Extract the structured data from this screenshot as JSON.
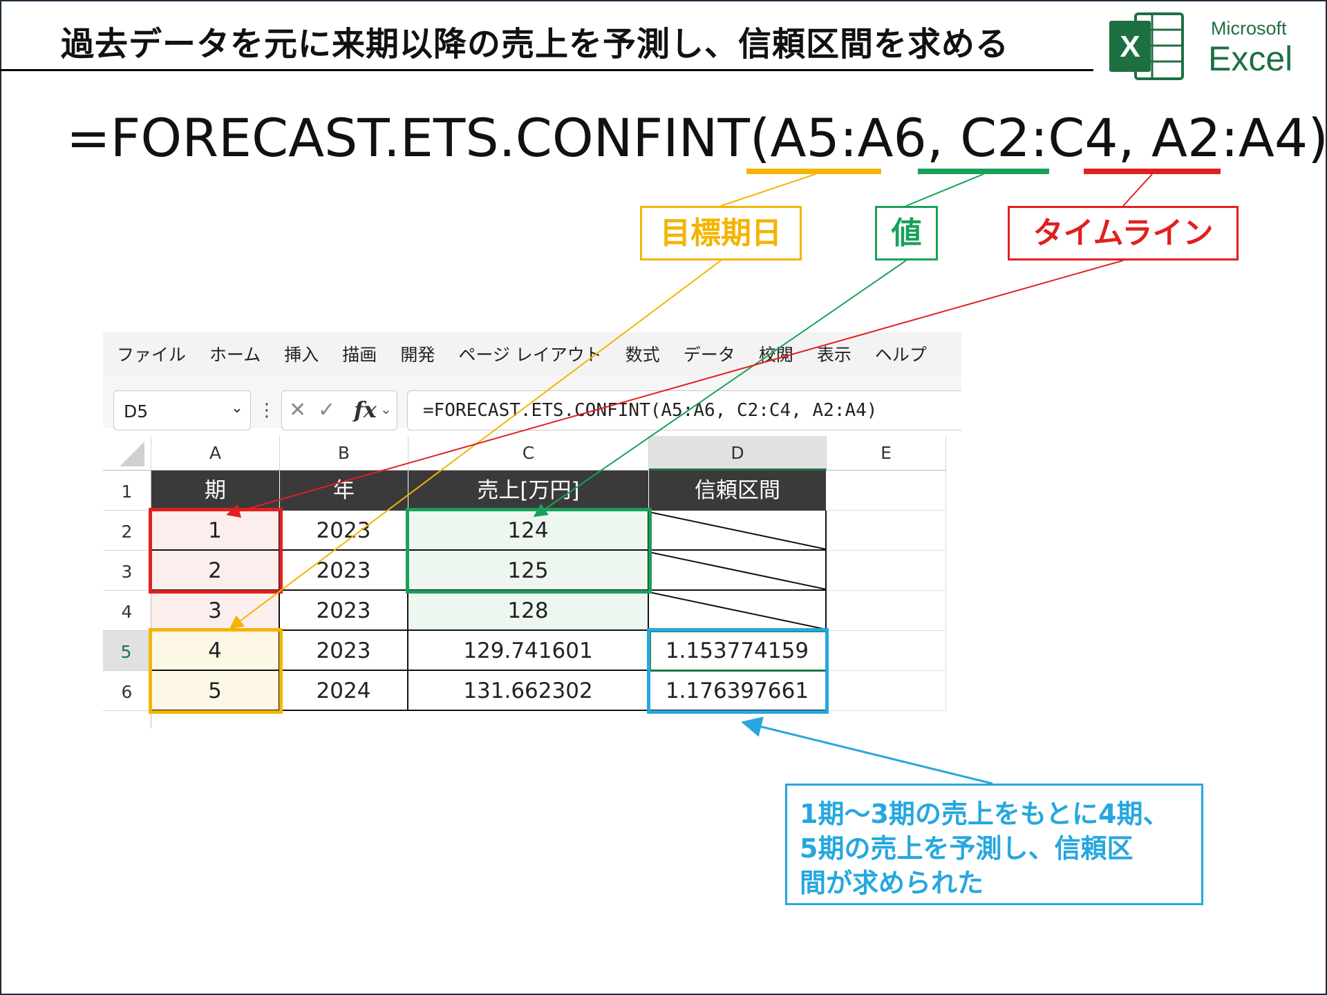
{
  "header": {
    "title": "過去データを元に来期以降の売上を予測し、信頼区間を求める",
    "logo_microsoft": "Microsoft",
    "logo_excel": "Excel",
    "logo_letter": "X"
  },
  "formula_display": {
    "prefix": "=FORECAST.ETS.CONFINT(",
    "arg1": "A5:A6",
    "sep1": ", ",
    "arg2": "C2:C4",
    "sep2": ", ",
    "arg3": "A2:A4",
    "suffix": ")"
  },
  "callouts": {
    "target_date": "目標期日",
    "values": "値",
    "timeline": "タイムライン",
    "note_lines": [
      "1期～3期の売上をもとに4期、",
      "5期の売上を予測し、信頼区",
      "間が求められた"
    ]
  },
  "excel": {
    "ribbon_tabs": [
      "ファイル",
      "ホーム",
      "挿入",
      "描画",
      "開発",
      "ページ レイアウト",
      "数式",
      "データ",
      "校閲",
      "表示",
      "ヘルプ"
    ],
    "name_box": "D5",
    "formula_bar": "=FORECAST.ETS.CONFINT(A5:A6, C2:C4, A2:A4)",
    "fx_label": "fx",
    "columns": [
      "A",
      "B",
      "C",
      "D",
      "E"
    ],
    "row_numbers": [
      "1",
      "2",
      "3",
      "4",
      "5",
      "6"
    ],
    "table_headers": [
      "期",
      "年",
      "売上[万円]",
      "信頼区間"
    ],
    "rows": [
      {
        "period": "1",
        "year": "2023",
        "sales": "124",
        "confint": ""
      },
      {
        "period": "2",
        "year": "2023",
        "sales": "125",
        "confint": ""
      },
      {
        "period": "3",
        "year": "2023",
        "sales": "128",
        "confint": ""
      },
      {
        "period": "4",
        "year": "2023",
        "sales": "129.741601",
        "confint": "1.153774159"
      },
      {
        "period": "5",
        "year": "2024",
        "sales": "131.662302",
        "confint": "1.176397661"
      }
    ]
  },
  "colors": {
    "timeline": "#e0201e",
    "values": "#1aa05a",
    "target": "#f4b400",
    "note": "#26a7df",
    "excel_green": "#217346"
  }
}
